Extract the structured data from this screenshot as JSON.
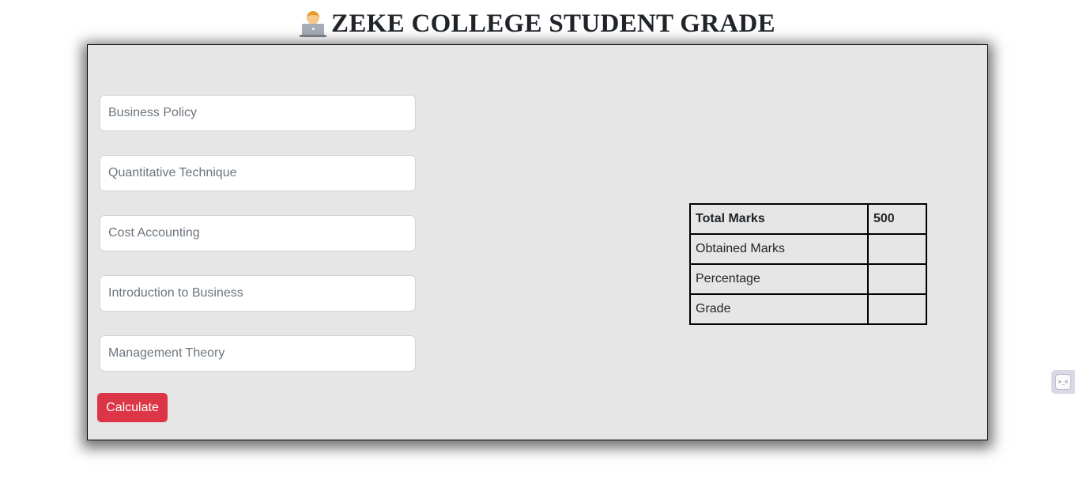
{
  "header": {
    "title": "ZEKE COLLEGE STUDENT GRADE",
    "icon": "technologist-emoji-icon"
  },
  "form": {
    "inputs": [
      {
        "placeholder": "Business Policy",
        "value": ""
      },
      {
        "placeholder": "Quantitative Technique",
        "value": ""
      },
      {
        "placeholder": "Cost Accounting",
        "value": ""
      },
      {
        "placeholder": "Introduction to Business",
        "value": ""
      },
      {
        "placeholder": "Management Theory",
        "value": ""
      }
    ],
    "calculate_label": "Calculate"
  },
  "results": {
    "rows": [
      {
        "label": "Total Marks",
        "value": "500"
      },
      {
        "label": "Obtained Marks",
        "value": ""
      },
      {
        "label": "Percentage",
        "value": ""
      },
      {
        "label": "Grade",
        "value": ""
      }
    ]
  },
  "colors": {
    "panel_background": "#e6e6e6",
    "button_background": "#dc3545",
    "button_text": "#ffffff"
  },
  "side_widget": {
    "icon": "terminal-extension-icon",
    "glyph": ">_<"
  }
}
